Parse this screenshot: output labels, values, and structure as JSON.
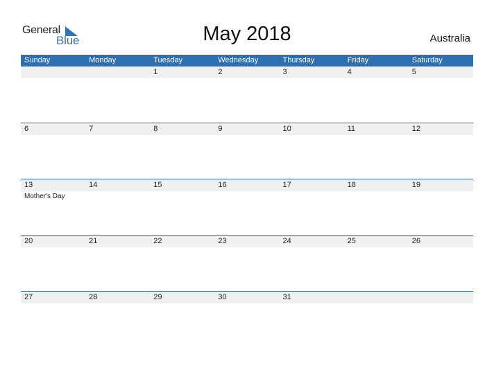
{
  "logo": {
    "word1": "General",
    "word2": "Blue",
    "icon": "triangle-flag-icon",
    "accent": "#2e75b6"
  },
  "title": "May 2018",
  "country": "Australia",
  "colors": {
    "header_bg": "#2e6fb0",
    "band_bg": "#f0f0f0"
  },
  "weekdays": [
    "Sunday",
    "Monday",
    "Tuesday",
    "Wednesday",
    "Thursday",
    "Friday",
    "Saturday"
  ],
  "weeks": [
    {
      "days": [
        "",
        "",
        "1",
        "2",
        "3",
        "4",
        "5"
      ],
      "events": [
        "",
        "",
        "",
        "",
        "",
        "",
        ""
      ]
    },
    {
      "days": [
        "6",
        "7",
        "8",
        "9",
        "10",
        "11",
        "12"
      ],
      "events": [
        "",
        "",
        "",
        "",
        "",
        "",
        ""
      ]
    },
    {
      "days": [
        "13",
        "14",
        "15",
        "16",
        "17",
        "18",
        "19"
      ],
      "events": [
        "Mother's Day",
        "",
        "",
        "",
        "",
        "",
        ""
      ]
    },
    {
      "days": [
        "20",
        "21",
        "22",
        "23",
        "24",
        "25",
        "26"
      ],
      "events": [
        "",
        "",
        "",
        "",
        "",
        "",
        ""
      ]
    },
    {
      "days": [
        "27",
        "28",
        "29",
        "30",
        "31",
        "",
        ""
      ],
      "events": [
        "",
        "",
        "",
        "",
        "",
        "",
        ""
      ]
    }
  ]
}
